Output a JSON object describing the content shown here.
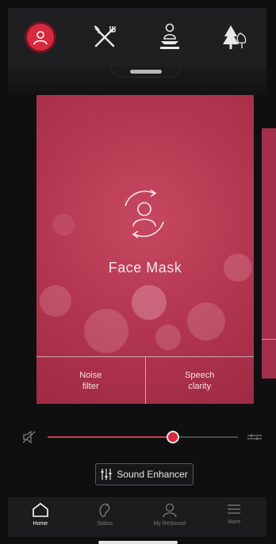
{
  "colors": {
    "accent": "#d8283f",
    "card": "#b33650",
    "background": "#0f0f10"
  },
  "programs": [
    {
      "icon": "person-mask-icon",
      "active": true
    },
    {
      "icon": "fork-knife-icon",
      "active": false
    },
    {
      "icon": "person-meditate-icon",
      "active": false
    },
    {
      "icon": "trees-icon",
      "active": false
    }
  ],
  "card": {
    "title": "Face Mask",
    "icon": "face-mask-cycle-icon",
    "actions": [
      {
        "label": "Noise\nfilter"
      },
      {
        "label": "Speech\nclarity"
      }
    ]
  },
  "volume": {
    "level": 0.66,
    "left_icon": "speaker-mute-icon",
    "right_icon": "volume-options-icon"
  },
  "enhancer": {
    "label": "Sound Enhancer",
    "icon": "equalizer-icon"
  },
  "nav": [
    {
      "label": "Home",
      "icon": "home-icon",
      "active": true
    },
    {
      "label": "Status",
      "icon": "status-icon",
      "active": false
    },
    {
      "label": "My ReSound",
      "icon": "person-icon",
      "active": false
    },
    {
      "label": "More",
      "icon": "menu-icon",
      "active": false
    }
  ]
}
